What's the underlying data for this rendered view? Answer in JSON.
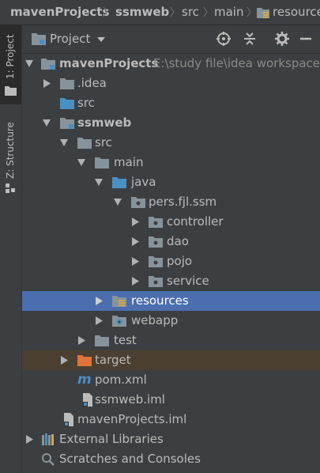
{
  "breadcrumb": [
    "mavenProjects",
    "ssmweb",
    "src",
    "main",
    "resources"
  ],
  "sidebar": {
    "project_tab": "1: Project",
    "structure_tab": "Z: Structure"
  },
  "panel": {
    "title": "Project",
    "icons": [
      "target-icon",
      "collapse-icon",
      "gear-icon",
      "minimize-icon"
    ]
  },
  "tree": {
    "root_label": "mavenProjects",
    "root_path": "E:\\study file\\idea workspace\\",
    "idea": ".idea",
    "root_src": "src",
    "module": "ssmweb",
    "src": "src",
    "main": "main",
    "java": "java",
    "package": "pers.fjl.ssm",
    "controller": "controller",
    "dao": "dao",
    "pojo": "pojo",
    "service": "service",
    "resources": "resources",
    "webapp": "webapp",
    "test": "test",
    "target": "target",
    "pom": "pom.xml",
    "module_iml": "ssmweb.iml",
    "root_iml": "mavenProjects.iml",
    "external_libraries": "External Libraries",
    "scratches": "Scratches and Consoles"
  },
  "colors": {
    "background": "#3c3f41",
    "selection": "#4b6eaf",
    "excluded": "#4a3f31",
    "folder": "#87939a",
    "source_folder": "#4a90c2"
  }
}
